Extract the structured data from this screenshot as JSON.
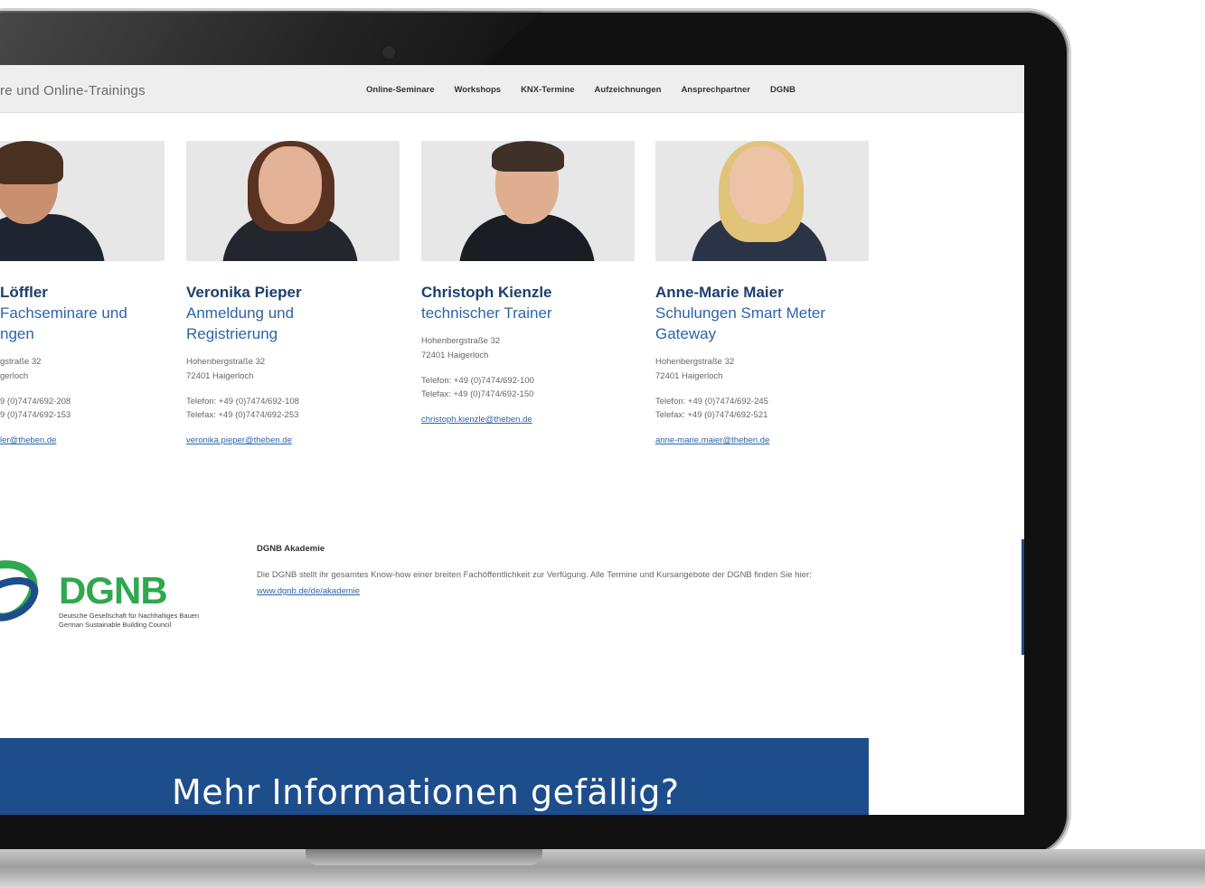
{
  "header": {
    "site_title": "re und Online-Trainings",
    "nav": [
      "Online-Seminare",
      "Workshops",
      "KNX-Termine",
      "Aufzeichnungen",
      "Ansprechpartner",
      "DGNB"
    ]
  },
  "contacts": [
    {
      "name": "Löffler",
      "role": [
        "Fachseminare und",
        "ngen"
      ],
      "address": [
        "gstraße 32",
        "gerloch"
      ],
      "phone": "9 (0)7474/692-208",
      "fax": "9 (0)7474/692-153",
      "email": "ler@theben.de"
    },
    {
      "name": "Veronika Pieper",
      "role": [
        "Anmeldung und",
        "Registrierung"
      ],
      "address": [
        "Hohenbergstraße 32",
        "72401 Haigerloch"
      ],
      "phone": "Telefon: +49 (0)7474/692-108",
      "fax": "Telefax: +49 (0)7474/692-253",
      "email": "veronika.pieper@theben.de"
    },
    {
      "name": "Christoph Kienzle",
      "role": [
        "technischer Trainer"
      ],
      "address": [
        "Hohenbergstraße 32",
        "72401 Haigerloch"
      ],
      "phone": "Telefon: +49 (0)7474/692-100",
      "fax": "Telefax: +49 (0)7474/692-150",
      "email": "christoph.kienzle@theben.de"
    },
    {
      "name": "Anne-Marie Maier",
      "role": [
        "Schulungen Smart Meter",
        "Gateway"
      ],
      "address": [
        "Hohenbergstraße 32",
        "72401 Haigerloch"
      ],
      "phone": "Telefon: +49 (0)7474/692-245",
      "fax": "Telefax: +49 (0)7474/692-521",
      "email": "anne-marie.maier@theben.de"
    }
  ],
  "dgnb": {
    "logo_text": "DGNB",
    "logo_sub_1": "Deutsche Gesellschaft für Nachhaltiges Bauen",
    "logo_sub_2": "German Sustainable Building Council",
    "title": "DGNB Akademie",
    "body": "Die DGNB stellt ihr gesamtes Know-how einer breiten Fachöffentlichkeit zur Verfügung. Alle Termine und Kursangebote der DGNB finden Sie hier: ",
    "link": "www.dgnb.de/de/akademie"
  },
  "banner": {
    "text": "Mehr Informationen gefällig?"
  },
  "colors": {
    "brand_blue": "#1e4d8c",
    "name_blue": "#1c3f6e",
    "link_blue": "#2e64a8",
    "dgnb_green": "#2fa84f"
  }
}
